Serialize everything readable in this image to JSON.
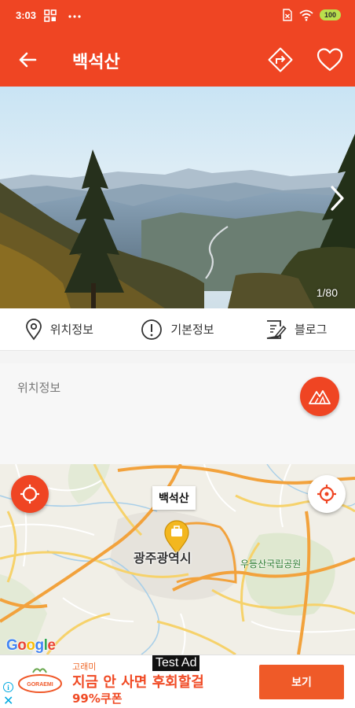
{
  "status_bar": {
    "time": "3:03",
    "icons": [
      "app-grid-icon",
      "more-dots-icon",
      "sim-icon",
      "wifi-icon",
      "battery-icon"
    ],
    "battery_level": "100",
    "color": "#ef4523"
  },
  "app_bar": {
    "title": "백석산",
    "color": "#ef4523"
  },
  "hero": {
    "counter": "1/80"
  },
  "tabs": [
    {
      "label": "위치정보",
      "icon": "location-pin-icon"
    },
    {
      "label": "기본정보",
      "icon": "info-circle-icon"
    },
    {
      "label": "블로그",
      "icon": "blog-edit-icon"
    }
  ],
  "location": {
    "title": "위치정보"
  },
  "map": {
    "callout": "백석산",
    "city_label": "광주광역시",
    "park_label": "우등산국립공원",
    "attribution": "Google"
  },
  "ad": {
    "test_label": "Test Ad",
    "brand": "고래미",
    "logo_text": "GORAEMI",
    "headline_1": "지금 안 사면 후회할걸",
    "headline_2": "99%쿠폰",
    "cta": "보기",
    "accent": "#ef5a28"
  }
}
